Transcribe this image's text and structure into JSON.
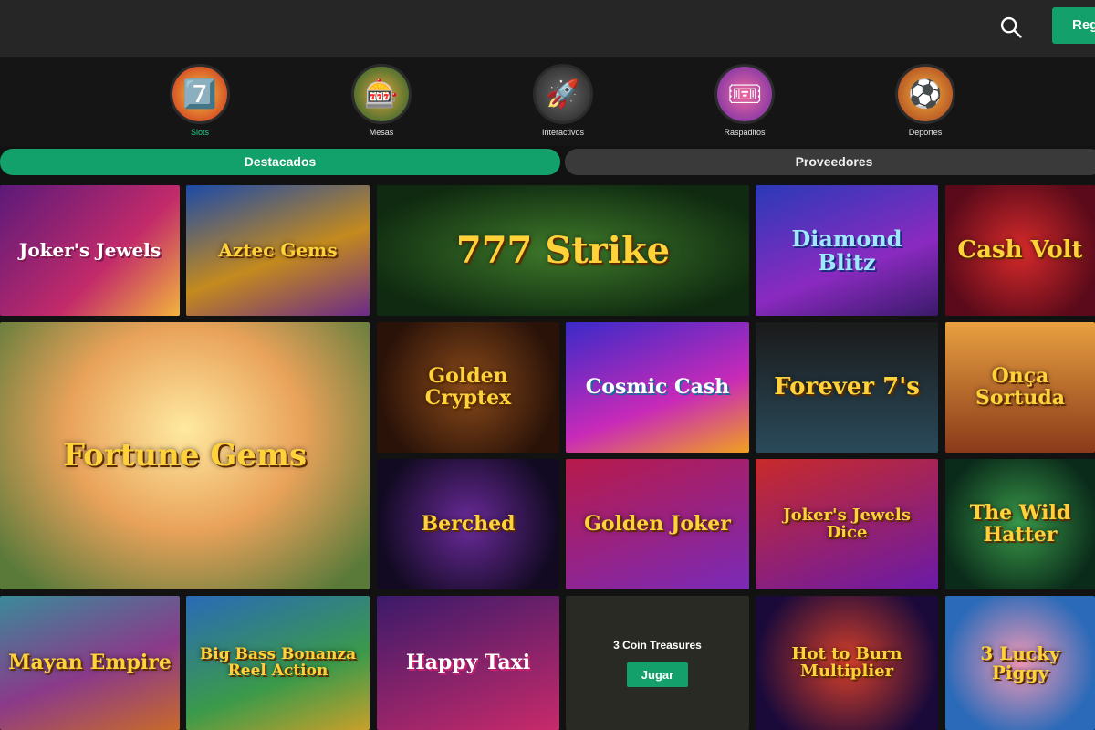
{
  "header": {
    "register_label": "Reg",
    "search_icon": "search-icon"
  },
  "categories": [
    {
      "label": "Slots",
      "icon": "slot-machine-icon",
      "glyph": "7️⃣",
      "active": true
    },
    {
      "label": "Mesas",
      "icon": "roulette-icon",
      "glyph": "🎰",
      "active": false
    },
    {
      "label": "Interactivos",
      "icon": "rocket-icon",
      "glyph": "🚀",
      "active": false
    },
    {
      "label": "Raspaditos",
      "icon": "scratch-card-icon",
      "glyph": "🎟",
      "active": false
    },
    {
      "label": "Deportes",
      "icon": "soccer-ball-icon",
      "glyph": "⚽",
      "active": false
    }
  ],
  "tabs": {
    "featured": "Destacados",
    "providers": "Proveedores"
  },
  "games": [
    {
      "title": "Joker's Jewels"
    },
    {
      "title": "Aztec Gems"
    },
    {
      "title": "777 Strike"
    },
    {
      "title": "Diamond Blitz"
    },
    {
      "title": "Cash Volt"
    },
    {
      "title": "Fortune Gems"
    },
    {
      "title": "Golden Cryptex"
    },
    {
      "title": "Cosmic Cash"
    },
    {
      "title": "Forever 7's"
    },
    {
      "title": "Onça Sortuda"
    },
    {
      "title": "Berched"
    },
    {
      "title": "Golden Joker"
    },
    {
      "title": "Joker's Jewels Dice"
    },
    {
      "title": "The Wild Hatter"
    },
    {
      "title": "Mayan Empire"
    },
    {
      "title": "Big Bass Bonanza Reel Action"
    },
    {
      "title": "Happy Taxi"
    },
    {
      "title": "3 Coin Treasures",
      "play_label": "Jugar"
    },
    {
      "title": "Hot to Burn Multiplier"
    },
    {
      "title": "3 Lucky Piggy"
    }
  ],
  "colors": {
    "accent": "#13a06b",
    "active_label": "#1fd18c",
    "topbar": "#262626",
    "background": "#121212"
  }
}
